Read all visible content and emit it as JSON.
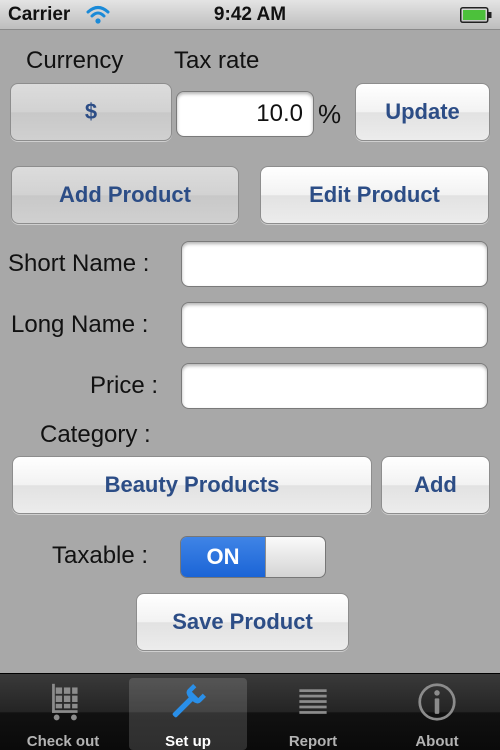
{
  "status_bar": {
    "carrier": "Carrier",
    "time": "9:42 AM"
  },
  "settings": {
    "currency_label": "Currency",
    "tax_rate_label": "Tax rate",
    "currency_value": "$",
    "tax_rate_value": "10.0",
    "percent_sign": "%",
    "update_label": "Update"
  },
  "mode_buttons": {
    "add_product": "Add Product",
    "edit_product": "Edit Product"
  },
  "form": {
    "short_name_label": "Short Name :",
    "short_name_value": "",
    "long_name_label": "Long Name :",
    "long_name_value": "",
    "price_label": "Price :",
    "price_value": "",
    "category_label": "Category :",
    "category_value": "Beauty Products",
    "add_category_label": "Add",
    "taxable_label": "Taxable :",
    "taxable_state": "ON",
    "save_label": "Save Product"
  },
  "tabs": [
    {
      "label": "Check out",
      "icon": "cart-icon"
    },
    {
      "label": "Set up",
      "icon": "wrench-icon",
      "selected": true
    },
    {
      "label": "Report",
      "icon": "report-list-icon"
    },
    {
      "label": "About",
      "icon": "info-icon"
    }
  ],
  "colors": {
    "accent_blue": "#2c4d86",
    "toggle_on": "#1b64d6",
    "background": "#a8a8a8"
  }
}
